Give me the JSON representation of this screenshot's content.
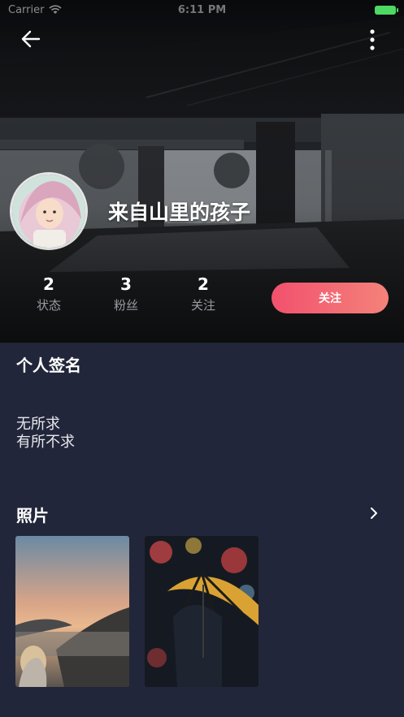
{
  "status_bar": {
    "carrier": "Carrier",
    "time": "6:11 PM"
  },
  "header": {
    "back_icon": "arrow-left-icon",
    "more_icon": "more-vertical-icon"
  },
  "profile": {
    "username": "来自山里的孩子",
    "stats": [
      {
        "count": "2",
        "label": "状态"
      },
      {
        "count": "3",
        "label": "粉丝"
      },
      {
        "count": "2",
        "label": "关注"
      }
    ],
    "follow_label": "关注"
  },
  "signature": {
    "title": "个人签名",
    "lines": [
      "无所求",
      "有所不求"
    ]
  },
  "photos": {
    "title": "照片",
    "arrow_icon": "chevron-right-icon"
  },
  "colors": {
    "background": "#22263a",
    "accent_start": "#f2516d",
    "accent_end": "#f4827a",
    "battery": "#4cd964"
  }
}
